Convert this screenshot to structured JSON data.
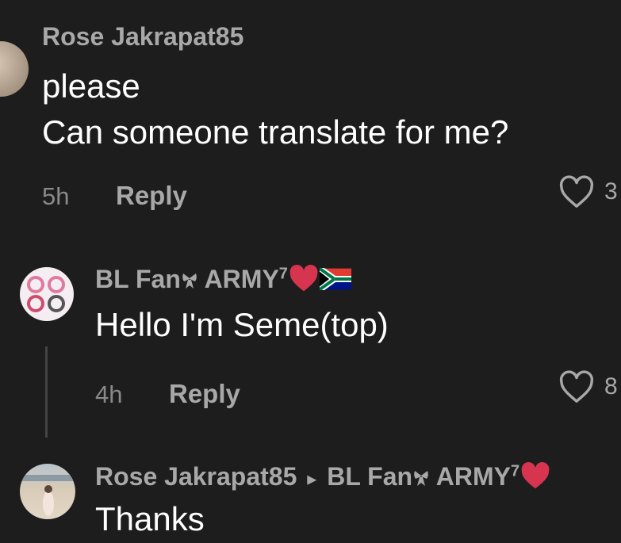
{
  "comments": [
    {
      "username": "Rose Jakrapat85",
      "lines": [
        "please",
        "Can someone translate for me?"
      ],
      "time": "5h",
      "reply_label": "Reply",
      "likes": "3"
    },
    {
      "username": "BL Fan",
      "username_suffix": " ARMY",
      "superscript": "7",
      "text": "Hello I'm Seme(top)",
      "time": "4h",
      "reply_label": "Reply",
      "likes": "8"
    },
    {
      "username": "Rose Jakrapat85",
      "reply_arrow": "▸",
      "reply_to": "BL Fan",
      "reply_to_suffix": " ARMY",
      "superscript": "7",
      "text": "Thanks"
    }
  ],
  "icons": {
    "like": "heart-outline-icon",
    "emoji_heart": "red-heart-emoji",
    "emoji_flag": "south-africa-flag-emoji",
    "emoji_ribbon": "ribbon-bow-emoji"
  },
  "colors": {
    "background": "#1d1d1d",
    "username": "#a8a8a8",
    "body_text": "#ffffff",
    "muted": "#8a8a8a",
    "emoji_heart": "#d6344f"
  }
}
